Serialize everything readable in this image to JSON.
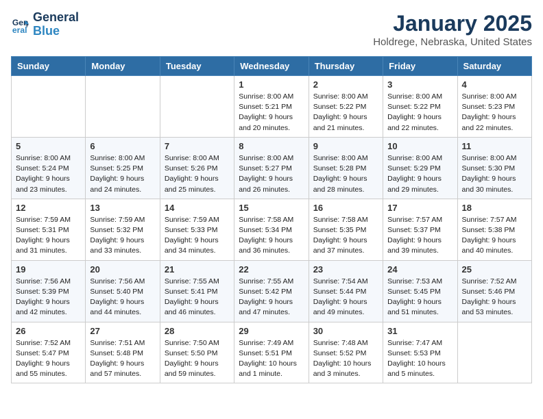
{
  "logo": {
    "line1": "General",
    "line2": "Blue"
  },
  "title": "January 2025",
  "location": "Holdrege, Nebraska, United States",
  "headers": [
    "Sunday",
    "Monday",
    "Tuesday",
    "Wednesday",
    "Thursday",
    "Friday",
    "Saturday"
  ],
  "weeks": [
    [
      {
        "day": "",
        "info": ""
      },
      {
        "day": "",
        "info": ""
      },
      {
        "day": "",
        "info": ""
      },
      {
        "day": "1",
        "info": "Sunrise: 8:00 AM\nSunset: 5:21 PM\nDaylight: 9 hours and 20 minutes."
      },
      {
        "day": "2",
        "info": "Sunrise: 8:00 AM\nSunset: 5:22 PM\nDaylight: 9 hours and 21 minutes."
      },
      {
        "day": "3",
        "info": "Sunrise: 8:00 AM\nSunset: 5:22 PM\nDaylight: 9 hours and 22 minutes."
      },
      {
        "day": "4",
        "info": "Sunrise: 8:00 AM\nSunset: 5:23 PM\nDaylight: 9 hours and 22 minutes."
      }
    ],
    [
      {
        "day": "5",
        "info": "Sunrise: 8:00 AM\nSunset: 5:24 PM\nDaylight: 9 hours and 23 minutes."
      },
      {
        "day": "6",
        "info": "Sunrise: 8:00 AM\nSunset: 5:25 PM\nDaylight: 9 hours and 24 minutes."
      },
      {
        "day": "7",
        "info": "Sunrise: 8:00 AM\nSunset: 5:26 PM\nDaylight: 9 hours and 25 minutes."
      },
      {
        "day": "8",
        "info": "Sunrise: 8:00 AM\nSunset: 5:27 PM\nDaylight: 9 hours and 26 minutes."
      },
      {
        "day": "9",
        "info": "Sunrise: 8:00 AM\nSunset: 5:28 PM\nDaylight: 9 hours and 28 minutes."
      },
      {
        "day": "10",
        "info": "Sunrise: 8:00 AM\nSunset: 5:29 PM\nDaylight: 9 hours and 29 minutes."
      },
      {
        "day": "11",
        "info": "Sunrise: 8:00 AM\nSunset: 5:30 PM\nDaylight: 9 hours and 30 minutes."
      }
    ],
    [
      {
        "day": "12",
        "info": "Sunrise: 7:59 AM\nSunset: 5:31 PM\nDaylight: 9 hours and 31 minutes."
      },
      {
        "day": "13",
        "info": "Sunrise: 7:59 AM\nSunset: 5:32 PM\nDaylight: 9 hours and 33 minutes."
      },
      {
        "day": "14",
        "info": "Sunrise: 7:59 AM\nSunset: 5:33 PM\nDaylight: 9 hours and 34 minutes."
      },
      {
        "day": "15",
        "info": "Sunrise: 7:58 AM\nSunset: 5:34 PM\nDaylight: 9 hours and 36 minutes."
      },
      {
        "day": "16",
        "info": "Sunrise: 7:58 AM\nSunset: 5:35 PM\nDaylight: 9 hours and 37 minutes."
      },
      {
        "day": "17",
        "info": "Sunrise: 7:57 AM\nSunset: 5:37 PM\nDaylight: 9 hours and 39 minutes."
      },
      {
        "day": "18",
        "info": "Sunrise: 7:57 AM\nSunset: 5:38 PM\nDaylight: 9 hours and 40 minutes."
      }
    ],
    [
      {
        "day": "19",
        "info": "Sunrise: 7:56 AM\nSunset: 5:39 PM\nDaylight: 9 hours and 42 minutes."
      },
      {
        "day": "20",
        "info": "Sunrise: 7:56 AM\nSunset: 5:40 PM\nDaylight: 9 hours and 44 minutes."
      },
      {
        "day": "21",
        "info": "Sunrise: 7:55 AM\nSunset: 5:41 PM\nDaylight: 9 hours and 46 minutes."
      },
      {
        "day": "22",
        "info": "Sunrise: 7:55 AM\nSunset: 5:42 PM\nDaylight: 9 hours and 47 minutes."
      },
      {
        "day": "23",
        "info": "Sunrise: 7:54 AM\nSunset: 5:44 PM\nDaylight: 9 hours and 49 minutes."
      },
      {
        "day": "24",
        "info": "Sunrise: 7:53 AM\nSunset: 5:45 PM\nDaylight: 9 hours and 51 minutes."
      },
      {
        "day": "25",
        "info": "Sunrise: 7:52 AM\nSunset: 5:46 PM\nDaylight: 9 hours and 53 minutes."
      }
    ],
    [
      {
        "day": "26",
        "info": "Sunrise: 7:52 AM\nSunset: 5:47 PM\nDaylight: 9 hours and 55 minutes."
      },
      {
        "day": "27",
        "info": "Sunrise: 7:51 AM\nSunset: 5:48 PM\nDaylight: 9 hours and 57 minutes."
      },
      {
        "day": "28",
        "info": "Sunrise: 7:50 AM\nSunset: 5:50 PM\nDaylight: 9 hours and 59 minutes."
      },
      {
        "day": "29",
        "info": "Sunrise: 7:49 AM\nSunset: 5:51 PM\nDaylight: 10 hours and 1 minute."
      },
      {
        "day": "30",
        "info": "Sunrise: 7:48 AM\nSunset: 5:52 PM\nDaylight: 10 hours and 3 minutes."
      },
      {
        "day": "31",
        "info": "Sunrise: 7:47 AM\nSunset: 5:53 PM\nDaylight: 10 hours and 5 minutes."
      },
      {
        "day": "",
        "info": ""
      }
    ]
  ]
}
